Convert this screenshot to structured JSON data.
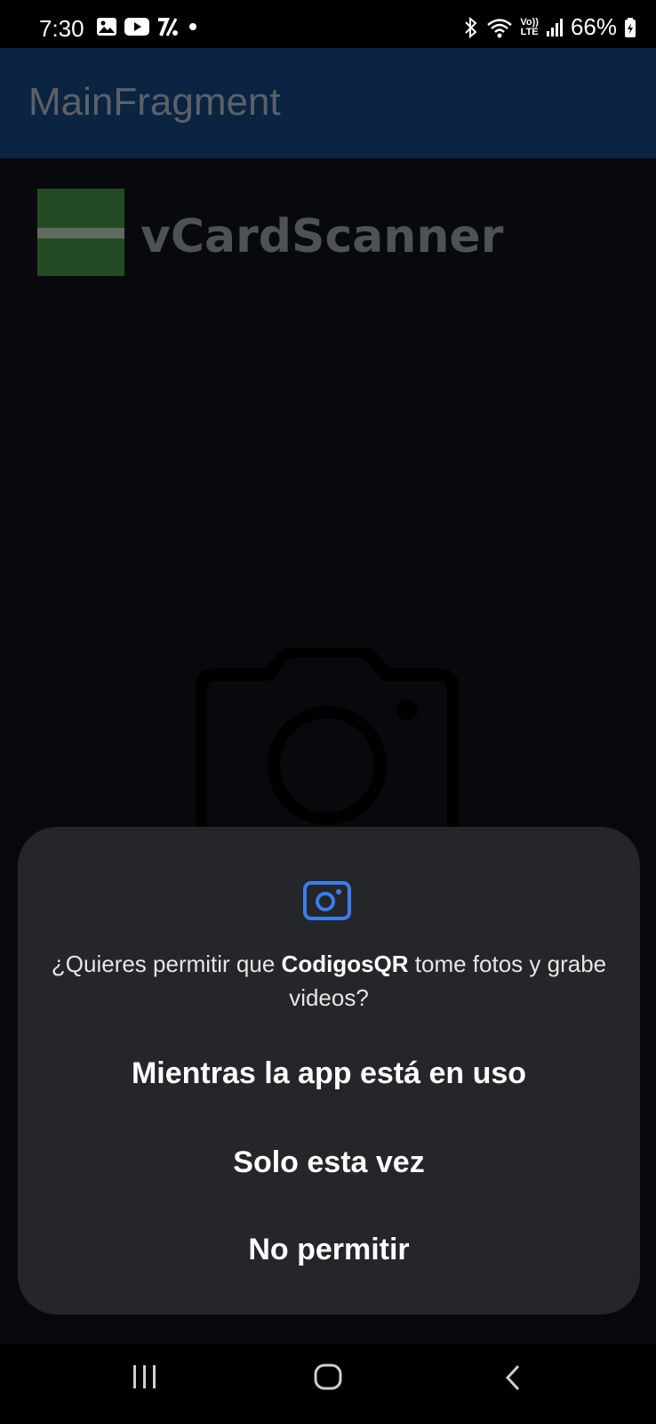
{
  "status_bar": {
    "time": "7:30",
    "battery": "66%",
    "left_icons": [
      "gallery-icon",
      "youtube-icon",
      "percent-app-icon",
      "notification-dot"
    ],
    "right_icons": [
      "bluetooth-icon",
      "wifi-icon",
      "volte-icon",
      "signal-icon",
      "battery-icon"
    ],
    "volte_label_top": "Vo))",
    "volte_label_bottom": "LTE"
  },
  "app_bar": {
    "title": "MainFragment",
    "background": "#0a2441"
  },
  "main": {
    "logo_text": "vCardScanner",
    "camera_icon": "camera-icon"
  },
  "dialog": {
    "icon": "camera-icon",
    "accent": "#3b7ded",
    "message_prefix": "¿Quieres permitir que ",
    "app_name": "CodigosQR",
    "message_suffix": " tome fotos y grabe videos?",
    "options": [
      "Mientras la app está en uso",
      "Solo esta vez",
      "No permitir"
    ]
  },
  "nav_bar": {
    "buttons": [
      "recents-icon",
      "home-icon",
      "back-icon"
    ]
  }
}
